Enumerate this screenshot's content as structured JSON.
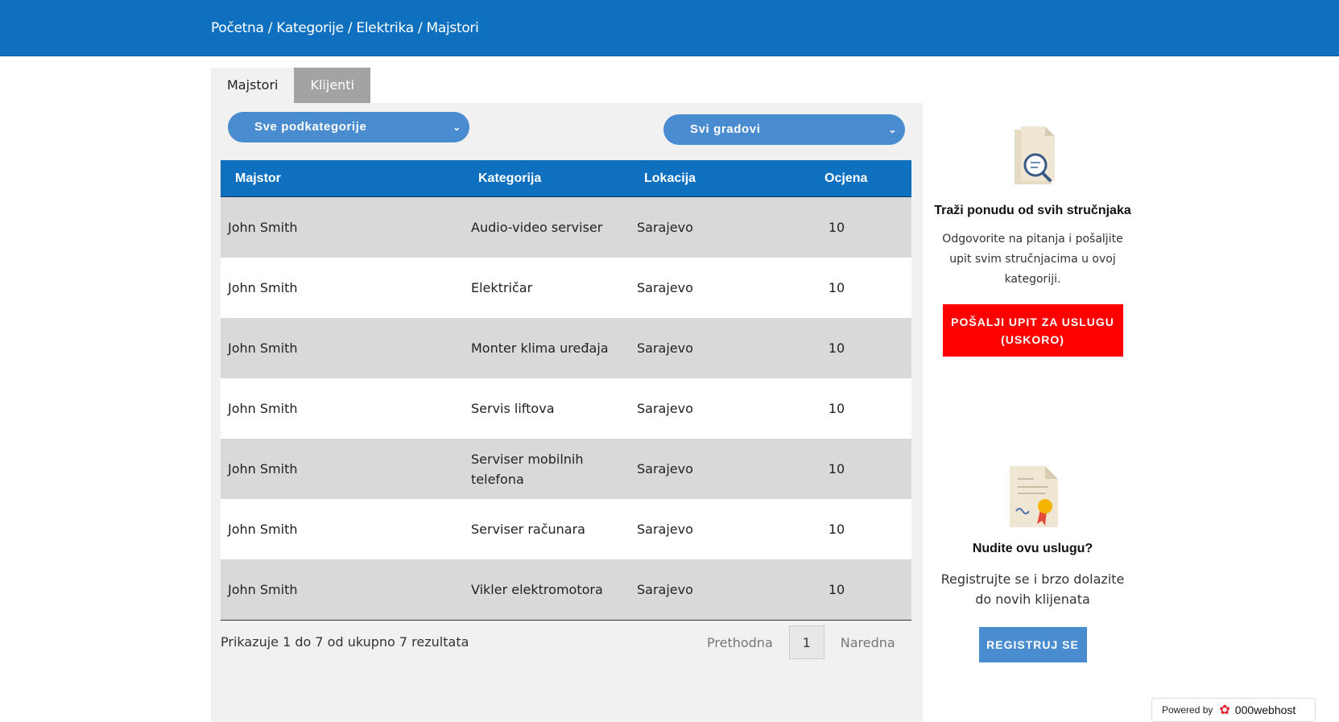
{
  "breadcrumb": {
    "home": "Početna",
    "categories": "Kategorije",
    "category": "Elektrika",
    "current": "Majstori",
    "separator": "/"
  },
  "tabs": [
    {
      "label": "Majstori",
      "active": true
    },
    {
      "label": "Klijenti",
      "active": false
    }
  ],
  "filters": {
    "subcategory": "Sve podkategorije",
    "city": "Svi gradovi"
  },
  "table": {
    "headers": [
      "Majstor",
      "Kategorija",
      "Lokacija",
      "Ocjena"
    ],
    "rows": [
      [
        "John Smith",
        "Audio-video serviser",
        "Sarajevo",
        "10"
      ],
      [
        "John Smith",
        "Električar",
        "Sarajevo",
        "10"
      ],
      [
        "John Smith",
        "Monter klima uređaja",
        "Sarajevo",
        "10"
      ],
      [
        "John Smith",
        "Servis liftova",
        "Sarajevo",
        "10"
      ],
      [
        "John Smith",
        "Serviser mobilnih telefona",
        "Sarajevo",
        "10"
      ],
      [
        "John Smith",
        "Serviser računara",
        "Sarajevo",
        "10"
      ],
      [
        "John Smith",
        "Vikler elektromotora",
        "Sarajevo",
        "10"
      ]
    ]
  },
  "pagination": {
    "info": "Prikazuje 1 do 7 od ukupno 7 rezultata",
    "prev": "Prethodna",
    "page": "1",
    "next": "Naredna"
  },
  "sidebar": {
    "request": {
      "title": "Traži ponudu od svih stručnjaka",
      "text": "Odgovorite na pitanja i pošaljite upit svim stručnjacima u ovoj kategoriji.",
      "button": "POŠALJI UPIT ZA USLUGU (USKORO)"
    },
    "offer": {
      "title": "Nudite ovu uslugu?",
      "text": "Registrujte se i brzo dolazite do novih klijenata",
      "button": "REGISTRUJ SE"
    }
  },
  "powered": {
    "label": "Powered by",
    "brand": "000webhost"
  },
  "colors": {
    "primary": "#0e70bf",
    "select": "#4a8cd0",
    "danger": "#ff0000",
    "panel": "#f1f1f1",
    "row_alt": "#d9d9d9"
  }
}
